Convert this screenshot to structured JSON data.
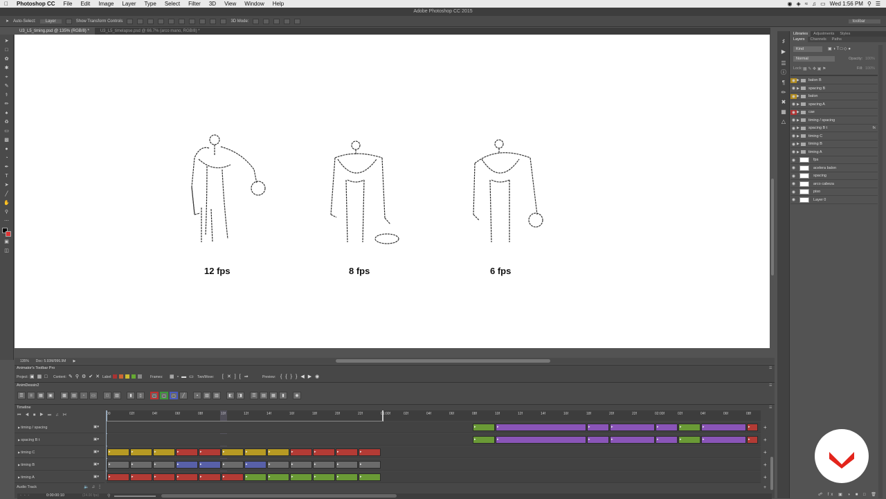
{
  "menubar": {
    "app": "Photoshop CC",
    "items": [
      "File",
      "Edit",
      "Image",
      "Layer",
      "Type",
      "Select",
      "Filter",
      "3D",
      "View",
      "Window",
      "Help"
    ],
    "clock": "Wed 1:56 PM"
  },
  "window_title": "Adobe Photoshop CC 2015",
  "options": {
    "auto_select_label": "Auto-Select:",
    "auto_select_value": "Layer",
    "transform_label": "Show Transform Controls",
    "mode_label": "3D Mode:",
    "workspace": "toolbar"
  },
  "doc_tabs": [
    "U3_L5_timing.psd @ 135% (RGB/8) *",
    "U3_L5_timelapse.psd @ 66.7% (arco mano, RGB/8) *"
  ],
  "canvas": {
    "labels": [
      "12 fps",
      "8 fps",
      "6 fps"
    ]
  },
  "status": {
    "zoom": "135%",
    "doc": "Doc: 5.93M/996.9M"
  },
  "panel": {
    "tabs": [
      "Libraries",
      "Adjustments",
      "Styles"
    ],
    "subtabs": [
      "Layers",
      "Channels",
      "Paths"
    ],
    "kind": "Kind",
    "blend": "Normal",
    "opacity_label": "Opacity:",
    "opacity": "100%",
    "lock_label": "Lock:",
    "fill_label": "Fill:",
    "fill": "100%",
    "layers": [
      {
        "name": "balon B",
        "type": "group",
        "eye_color": "#b08a1c"
      },
      {
        "name": "spacing B",
        "type": "group",
        "eye_color": ""
      },
      {
        "name": "balon",
        "type": "group",
        "eye_color": "#b08a1c"
      },
      {
        "name": "spacing A",
        "type": "group",
        "eye_color": ""
      },
      {
        "name": "cae",
        "type": "group",
        "eye_color": "#b03030"
      },
      {
        "name": "timing / spacing",
        "type": "group",
        "eye_color": ""
      },
      {
        "name": "spacing B t",
        "type": "group",
        "eye_color": "",
        "fx": "fx"
      },
      {
        "name": "timing C",
        "type": "group",
        "eye_color": ""
      },
      {
        "name": "timing B",
        "type": "group",
        "eye_color": ""
      },
      {
        "name": "timing A",
        "type": "group",
        "eye_color": ""
      },
      {
        "name": "fps",
        "type": "layer"
      },
      {
        "name": "acelera balon",
        "type": "layer"
      },
      {
        "name": "spacing",
        "type": "layer"
      },
      {
        "name": "arco cabeza",
        "type": "layer"
      },
      {
        "name": "piso",
        "type": "layer"
      },
      {
        "name": "Layer 0",
        "type": "layer"
      }
    ]
  },
  "atp": {
    "title": "Animator's Toolbar Pro",
    "project_label": "Project:",
    "content_label": "Content:",
    "label_label": "Label:",
    "frames_label": "Frames:",
    "tweenmove_label": "Twn/Move:",
    "preview_label": "Preview:",
    "anim_dessin": "AnimDessin2"
  },
  "timeline": {
    "title": "Timeline",
    "ruler": [
      "00",
      "02f",
      "04f",
      "06f",
      "08f",
      "10f",
      "12f",
      "14f",
      "16f",
      "18f",
      "20f",
      "22f",
      "01:00f",
      "02f",
      "04f",
      "06f",
      "08f",
      "10f",
      "12f",
      "14f",
      "16f",
      "18f",
      "20f",
      "22f",
      "02:00f",
      "02f",
      "04f",
      "06f",
      "08f"
    ],
    "tracks": [
      "timing / spacing",
      "spacing B t",
      "timing C",
      "timing B",
      "timing A"
    ],
    "audio": "Audio Track",
    "timecode": "0:00:00:10",
    "fps_readout": "(24.00 fps)",
    "colors": {
      "yellow": "#b79a23",
      "red": "#b33b35",
      "gray": "#6b6b6b",
      "blue": "#5860a8",
      "green": "#6a9a36",
      "purple": "#8a55b8"
    }
  }
}
